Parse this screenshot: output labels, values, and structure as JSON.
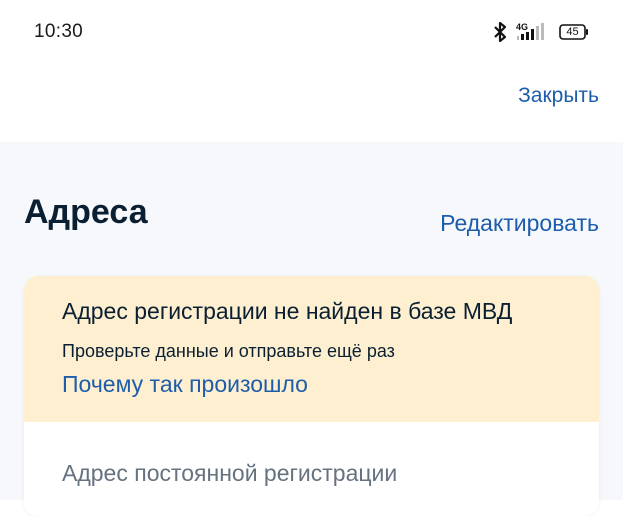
{
  "status_bar": {
    "time": "10:30",
    "network": "4G",
    "battery": "45",
    "icons": [
      "bluetooth-icon",
      "signal-icon",
      "battery-icon"
    ]
  },
  "header": {
    "close_label": "Закрыть"
  },
  "page": {
    "title": "Адреса",
    "edit_label": "Редактировать"
  },
  "warning": {
    "title": "Адрес регистрации не найден в базе МВД",
    "subtitle": "Проверьте данные и отправьте ещё раз",
    "link": "Почему так произошло"
  },
  "address": {
    "label": "Адрес постоянной регистрации"
  },
  "colors": {
    "accent": "#1d5dab",
    "warning_bg": "#fdefcf",
    "content_bg": "#f6f8fb",
    "text_primary": "#0b1f33",
    "text_secondary": "#66727f"
  }
}
